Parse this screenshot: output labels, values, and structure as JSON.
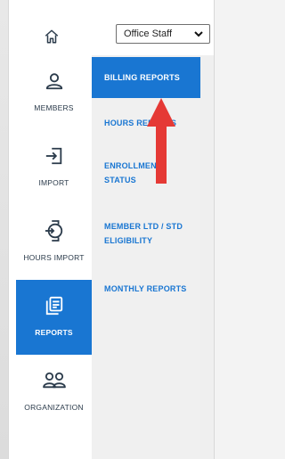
{
  "top_bar": {
    "home_icon": "home-icon",
    "role_select": {
      "value": "Office Staff"
    }
  },
  "sidebar": {
    "items": [
      {
        "label": "MEMBERS",
        "icon": "person-icon",
        "active": false
      },
      {
        "label": "IMPORT",
        "icon": "import-icon",
        "active": false
      },
      {
        "label": "HOURS IMPORT",
        "icon": "watch-import-icon",
        "active": false
      },
      {
        "label": "REPORTS",
        "icon": "reports-icon",
        "active": true
      },
      {
        "label": "ORGANIZATION",
        "icon": "people-icon",
        "active": false
      }
    ]
  },
  "subnav": {
    "items": [
      {
        "label": "BILLING REPORTS",
        "active": true
      },
      {
        "label": "HOURS REPORTS",
        "active": false
      },
      {
        "label": "ENROLLMENT STATUS",
        "active": false
      },
      {
        "label": "MEMBER LTD / STD ELIGIBILITY",
        "active": false
      },
      {
        "label": "MONTHLY REPORTS",
        "active": false
      }
    ]
  },
  "colors": {
    "accent": "#1976d2",
    "annotation_arrow": "#e53935",
    "subnav_bg": "#f0f0f0"
  }
}
